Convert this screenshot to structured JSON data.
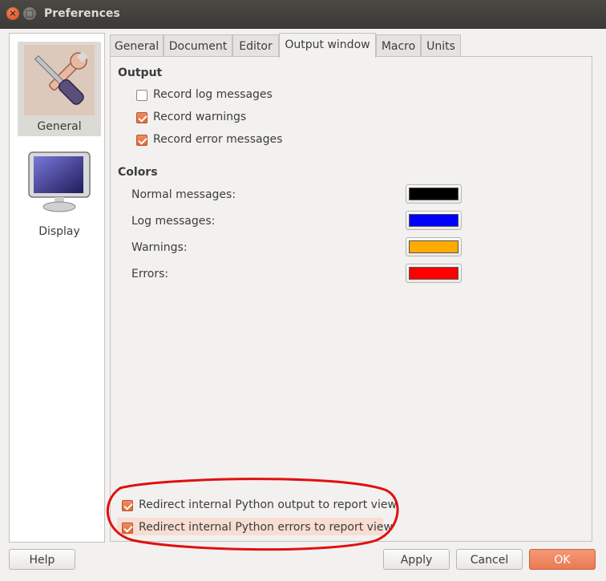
{
  "window": {
    "title": "Preferences"
  },
  "sidebar": {
    "items": [
      {
        "label": "General",
        "icon": "tools-icon",
        "selected": true
      },
      {
        "label": "Display",
        "icon": "monitor-icon",
        "selected": false
      }
    ]
  },
  "tabs": [
    {
      "label": "General",
      "active": false
    },
    {
      "label": "Document",
      "active": false
    },
    {
      "label": "Editor",
      "active": false
    },
    {
      "label": "Output window",
      "active": true
    },
    {
      "label": "Macro",
      "active": false
    },
    {
      "label": "Units",
      "active": false
    }
  ],
  "output": {
    "title": "Output",
    "options": [
      {
        "label": "Record log messages",
        "checked": false
      },
      {
        "label": "Record warnings",
        "checked": true
      },
      {
        "label": "Record error messages",
        "checked": true
      }
    ]
  },
  "colors": {
    "title": "Colors",
    "items": [
      {
        "label": "Normal messages:",
        "color": "#000000"
      },
      {
        "label": "Log messages:",
        "color": "#0000ff"
      },
      {
        "label": "Warnings:",
        "color": "#ffaa00"
      },
      {
        "label": "Errors:",
        "color": "#ff0000"
      }
    ]
  },
  "redirect": {
    "options": [
      {
        "label": "Redirect internal Python output to report view",
        "checked": true
      },
      {
        "label": "Redirect internal Python errors to report view",
        "checked": true
      }
    ],
    "annotation_color": "#e01010"
  },
  "buttons": {
    "help": "Help",
    "apply": "Apply",
    "cancel": "Cancel",
    "ok": "OK"
  },
  "theme": {
    "accent": "#e9764b",
    "selection": "#f8ddd2"
  }
}
